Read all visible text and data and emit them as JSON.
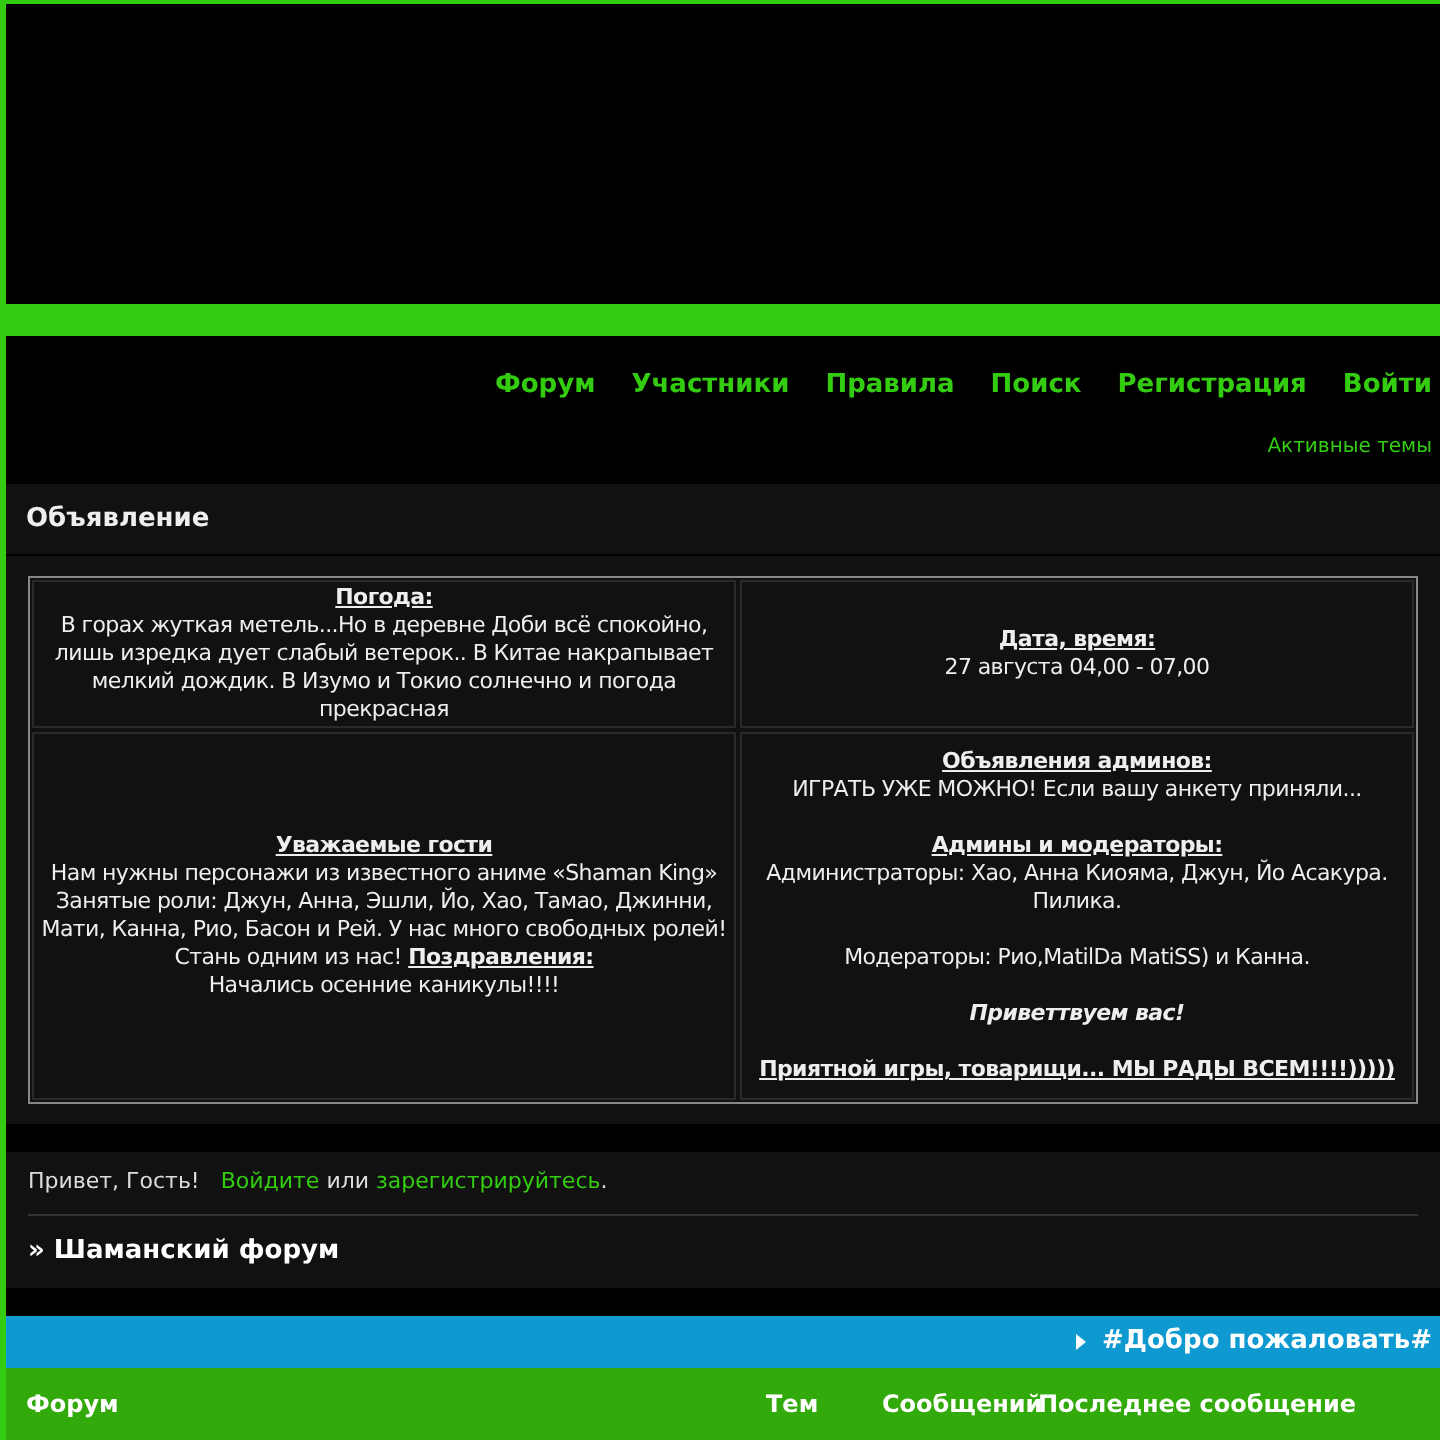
{
  "nav": [
    {
      "label": "Форум"
    },
    {
      "label": "Участники"
    },
    {
      "label": "Правила"
    },
    {
      "label": "Поиск"
    },
    {
      "label": "Регистрация"
    },
    {
      "label": "Войти"
    }
  ],
  "active_topics": "Активные темы",
  "announcement": {
    "title": "Объявление",
    "cells": [
      {
        "paragraphs": [
          [
            {
              "kind": "heading",
              "text": "Погода:"
            },
            {
              "kind": "text",
              "text": "В горах жуткая метель...Но в деревне Доби всё спокойно, лишь изредка дует слабый ветерок.. В Китае накрапывает мелкий дождик. В Изумо и Токио солнечно и погода прекрасная"
            }
          ]
        ]
      },
      {
        "paragraphs": [
          [
            {
              "kind": "heading",
              "text": "Дата, время:"
            },
            {
              "kind": "text",
              "text": "27 августа 04,00 - 07,00"
            }
          ]
        ]
      },
      {
        "paragraphs": [
          [
            {
              "kind": "heading",
              "text": "Уважаемые гости"
            },
            {
              "kind": "text",
              "text": "Нам нужны персонажи из известного аниме «Shaman King» Занятые роли: Джун, Анна, Эшли, Йо, Хао, Тамао, Джинни, Мати, Канна, Рио, Басон и Рей. У нас много свободных ролей! Стань одним из нас! **Поздравления:**"
            },
            {
              "kind": "text",
              "text": "Начались осенние каникулы!!!!"
            }
          ]
        ]
      },
      {
        "paragraphs": [
          [
            {
              "kind": "heading",
              "text": "Объявления админов:"
            },
            {
              "kind": "text",
              "text": "ИГРАТЬ УЖЕ МОЖНО! Если вашу анкету приняли..."
            }
          ],
          [
            {
              "kind": "heading",
              "text": "Админы и модераторы:"
            },
            {
              "kind": "text",
              "text": "Администраторы: Хао, Анна Киояма, Джун, Йо Асакура. Пилика."
            }
          ],
          [
            {
              "kind": "text",
              "text": "Модераторы: Рио,MatilDa MatiSS) и Канна."
            }
          ],
          [
            {
              "kind": "italic",
              "text": "Приветтвуем вас!"
            }
          ],
          [
            {
              "kind": "heading",
              "text": "Приятной игры, товарищи... МЫ РАДЫ ВСЕМ!!!!)))))"
            }
          ]
        ]
      }
    ]
  },
  "greeting": {
    "prefix": "Привет, Гость!",
    "login_link": "Войдите",
    "middle": "или",
    "register_link": "зарегистрируйтесь",
    "suffix": "."
  },
  "breadcrumb": "» Шаманский форум",
  "category": {
    "title": "#Добро пожаловать#",
    "expanded": false
  },
  "table": {
    "columns": [
      "Форум",
      "Тем",
      "Сообщений",
      "Последнее сообщение"
    ]
  }
}
